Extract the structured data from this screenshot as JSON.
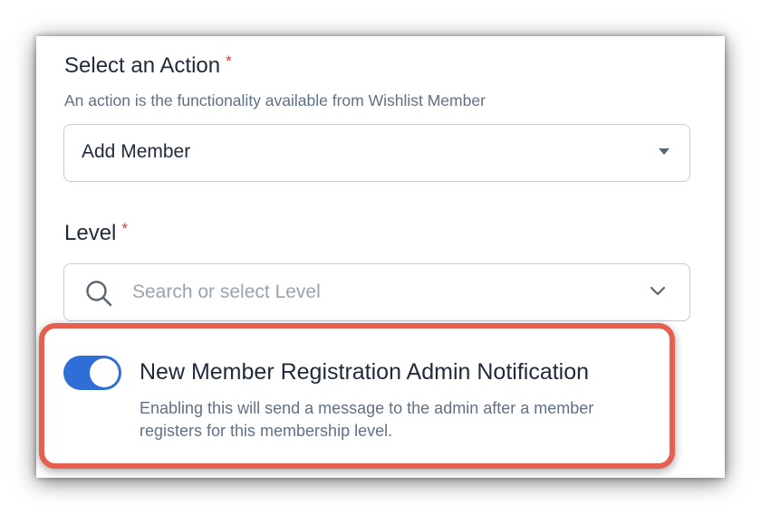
{
  "action": {
    "label": "Select an Action",
    "required_mark": "*",
    "help": "An action is the functionality available from Wishlist Member",
    "value": "Add Member"
  },
  "level": {
    "label": "Level",
    "required_mark": "*",
    "placeholder": "Search or select Level"
  },
  "notification": {
    "enabled": true,
    "title": "New Member Registration Admin Notification",
    "description": "Enabling this will send a message to the admin after a member registers for this membership level."
  },
  "colors": {
    "accent": "#2f6ed6",
    "required": "#d83a3a",
    "highlight": "#e6604f"
  },
  "icons": {
    "action_dropdown": "caret-down-icon",
    "level_search": "search-icon",
    "level_dropdown": "chevron-down-icon"
  }
}
